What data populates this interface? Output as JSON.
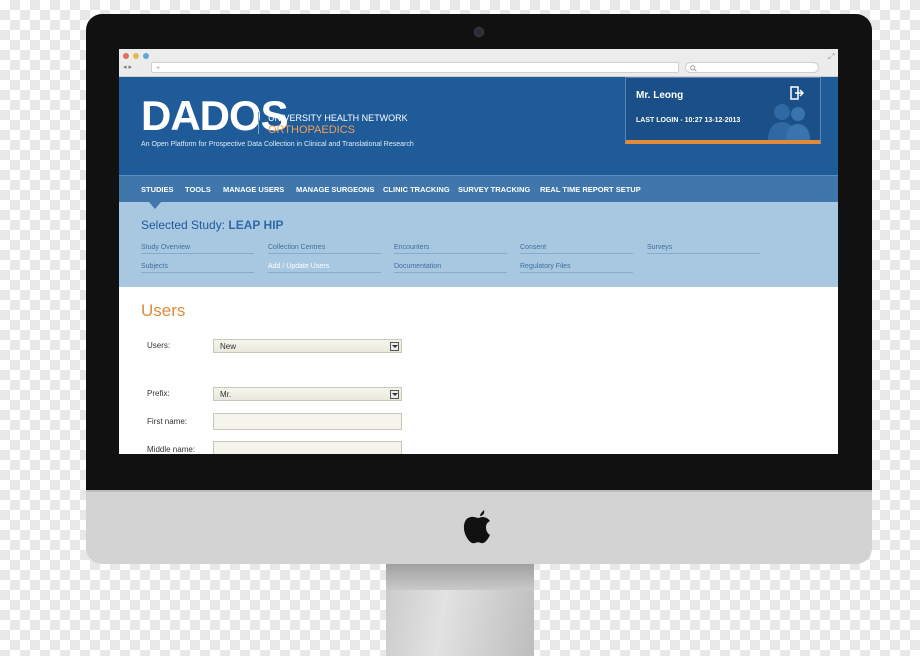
{
  "browser": {
    "nav_buttons": "◂ ▸",
    "address": "+",
    "search_icon": "search-icon"
  },
  "app": {
    "logo": "DADOS",
    "org_name": "UNIVERSITY HEALTH NETWORK",
    "department": "ORTHOPAEDICS",
    "tagline": "An Open Platform for Prospective Data Collection in Clinical and Translational Research"
  },
  "user": {
    "name": "Mr. Leong",
    "last_login": "LAST LOGIN - 10:27 13-12-2013"
  },
  "menu": [
    "STUDIES",
    "TOOLS",
    "MANAGE USERS",
    "MANAGE SURGEONS",
    "CLINIC TRACKING",
    "SURVEY TRACKING",
    "REAL TIME REPORT SETUP"
  ],
  "study": {
    "label": "Selected Study:",
    "name": "LEAP HIP",
    "links": [
      "Study Overview",
      "Collection Centres",
      "Encounters",
      "Consent",
      "Surveys",
      "Subjects",
      "Add / Update Users",
      "Documentation",
      "Regulatory Files"
    ],
    "active_link": "Add / Update Users"
  },
  "form": {
    "title": "Users",
    "users_label": "Users:",
    "users_value": "New",
    "prefix_label": "Prefix:",
    "prefix_value": "Mr.",
    "first_name_label": "First name:",
    "middle_name_label": "Middle name:"
  },
  "colors": {
    "header": "#1f5a99",
    "menubar": "#3f77ad",
    "study_bar": "#a8c8e2",
    "accent": "#e08a3a"
  }
}
